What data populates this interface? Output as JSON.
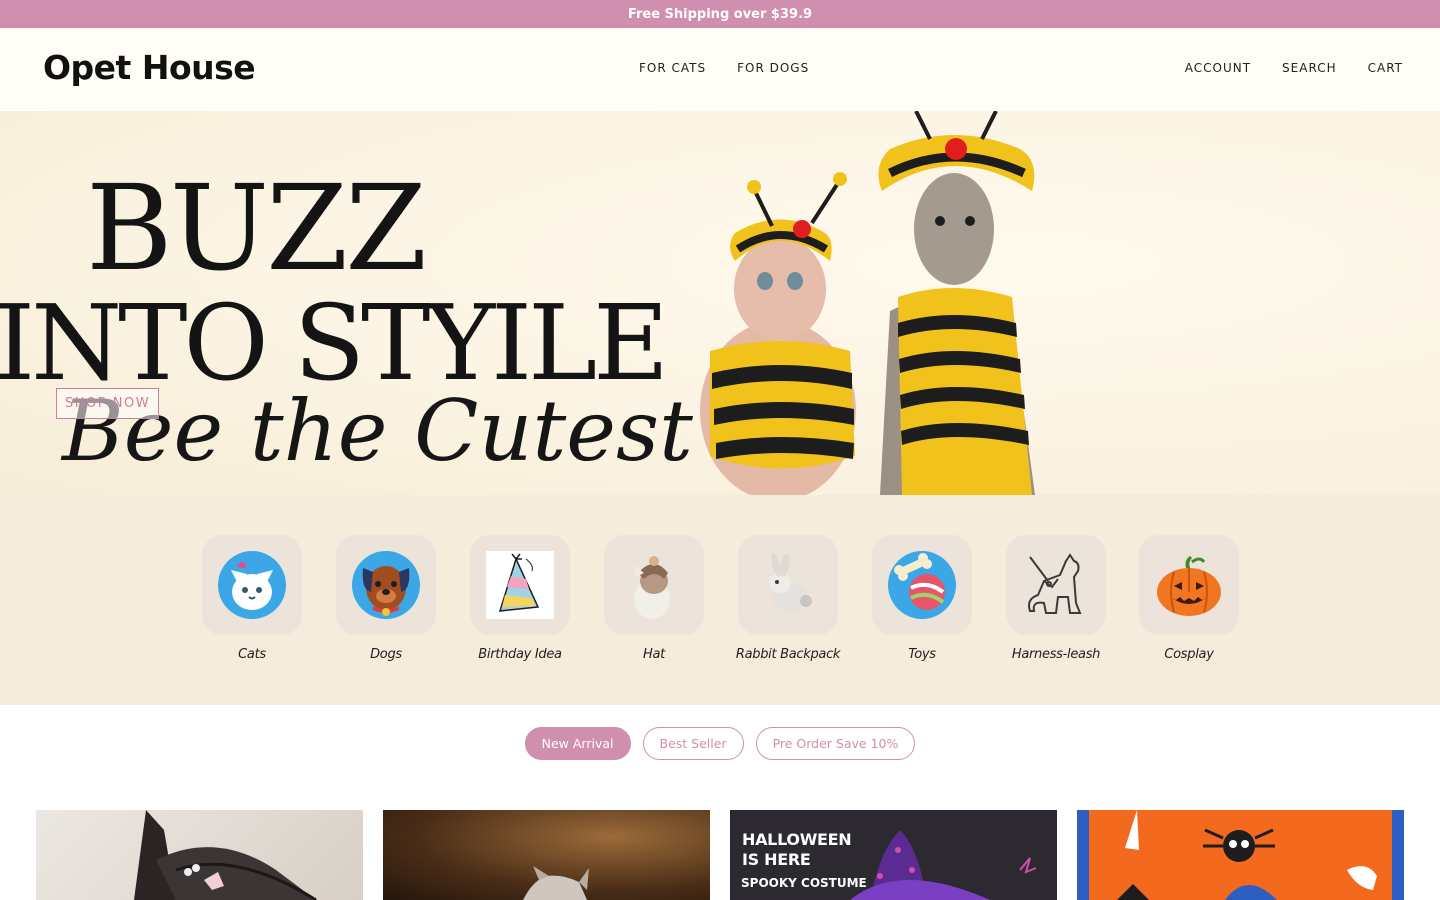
{
  "announcement": "Free Shipping over $39.9",
  "header": {
    "logo": "Opet House",
    "nav_left": [
      "FOR CATS",
      "FOR DOGS"
    ],
    "nav_right": [
      "ACCOUNT",
      "SEARCH",
      "CART"
    ]
  },
  "hero": {
    "line1": "BUZZ",
    "line2": "INTO STYILE",
    "script": "Bee the Cutest",
    "cta": "SHOP NOW"
  },
  "categories": [
    {
      "label": "Cats",
      "icon": "cat-face-icon"
    },
    {
      "label": "Dogs",
      "icon": "dog-face-icon"
    },
    {
      "label": "Birthday Idea",
      "icon": "party-hat-icon"
    },
    {
      "label": "Hat",
      "icon": "pet-hat-icon"
    },
    {
      "label": "Rabbit Backpack",
      "icon": "rabbit-icon"
    },
    {
      "label": "Toys",
      "icon": "toy-ball-bone-icon"
    },
    {
      "label": "Harness-leash",
      "icon": "harness-cat-icon"
    },
    {
      "label": "Cosplay",
      "icon": "pumpkin-icon"
    }
  ],
  "tabs": [
    {
      "label": "New Arrival",
      "active": true
    },
    {
      "label": "Best Seller",
      "active": false
    },
    {
      "label": "Pre Order Save 10%",
      "active": false
    }
  ],
  "products": {
    "promo_title_1": "HALLOWEEN",
    "promo_title_2": "IS HERE",
    "promo_subtitle": "SPOOKY COSTUME"
  },
  "colors": {
    "brand_pink": "#d08fae",
    "cream": "#f5ecdb",
    "header_bg": "#fffdf6"
  }
}
